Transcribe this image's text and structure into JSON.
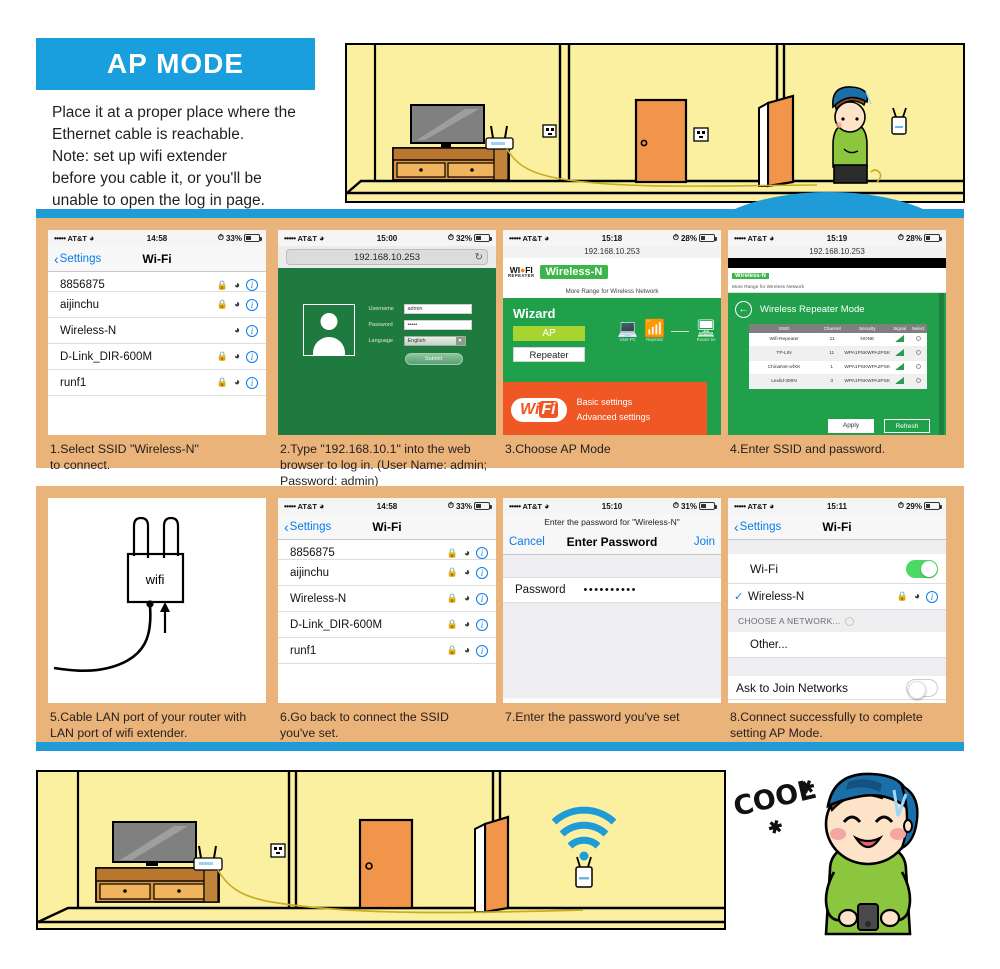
{
  "header": {
    "badge_label": "AP MODE",
    "intro_lines": [
      "Place it at a proper place where the",
      "Ethernet cable is reachable.",
      "Note: set up wifi extender",
      "before you cable it, or you'll be",
      "unable to open the log in page."
    ],
    "badge_color": "#199ede"
  },
  "colors": {
    "accent_blue": "#199ede",
    "panel_orange": "#eab379",
    "router_green": "#1f7a3f",
    "wizard_green": "#21a04c",
    "wifi_orange": "#ef5724",
    "ios_blue": "#0a7ce8",
    "toggle_green": "#4cd964",
    "wall_yellow": "#fbf0a0",
    "door_orange": "#f0954a"
  },
  "steps": [
    {
      "number": "1",
      "caption": "1.Select SSID \"Wireless-N\"\nto connect."
    },
    {
      "number": "2",
      "caption": "2.Type \"192.168.10.1\" into the web\nbrowser to log in. (User Name: admin;\nPassword: admin)"
    },
    {
      "number": "3",
      "caption": "3.Choose AP Mode"
    },
    {
      "number": "4",
      "caption": "4.Enter SSID and password."
    },
    {
      "number": "5",
      "caption": "5.Cable LAN port of your router with\nLAN port of wifi extender."
    },
    {
      "number": "6",
      "caption": "6.Go back to connect the SSID\nyou've set."
    },
    {
      "number": "7",
      "caption": "7.Enter the password you've set"
    },
    {
      "number": "8",
      "caption": "8.Connect successfully to complete\nsetting AP Mode."
    }
  ],
  "screens": {
    "s1_wifi_list": {
      "status": {
        "carrier": "AT&T",
        "signal_dots": "•••••",
        "time": "14:58",
        "battery": "33%"
      },
      "nav": {
        "back_label": "Settings",
        "title": "Wi-Fi"
      },
      "networks": [
        {
          "ssid": "8856875",
          "locked": true
        },
        {
          "ssid": "aijinchu",
          "locked": true
        },
        {
          "ssid": "Wireless-N",
          "locked": false
        },
        {
          "ssid": "D-Link_DIR-600M",
          "locked": true
        },
        {
          "ssid": "runf1",
          "locked": true
        }
      ]
    },
    "s2_login": {
      "status": {
        "carrier": "AT&T",
        "signal_dots": "•••••",
        "time": "15:00",
        "battery": "32%"
      },
      "url": "192.168.10.253",
      "reload_icon": "reload-icon",
      "form": {
        "username_label": "Username",
        "username_value": "admin",
        "password_label": "Password",
        "password_value": "•••••",
        "language_label": "Language",
        "language_value": "English",
        "submit_label": "Submit"
      }
    },
    "s3_wizard": {
      "status": {
        "carrier": "AT&T",
        "signal_dots": "•••••",
        "time": "15:18",
        "battery": "28%"
      },
      "url": "192.168.10.253",
      "brand": {
        "logo_top": "WI FI",
        "logo_sub": "REPEATER",
        "chip": "Wireless-N",
        "tagline": "More Range for Wireless Network"
      },
      "wizard_title": "Wizard",
      "mode_ap": "AP",
      "mode_repeater": "Repeater",
      "diagram": [
        {
          "label": "User-PC",
          "icon": "laptop-icon"
        },
        {
          "label": "Repeater",
          "icon": "repeater-icon"
        },
        {
          "label": "Router Se",
          "icon": "router-icon"
        }
      ],
      "wifi_cloud": "WiFi",
      "links": [
        "Basic settings",
        "Advanced settings"
      ]
    },
    "s4_repeater": {
      "status": {
        "carrier": "AT&T",
        "signal_dots": "•••••",
        "time": "15:19",
        "battery": "28%"
      },
      "url": "192.168.10.253",
      "chip": "Wireless-N",
      "tagline": "More Range for Wireless Network",
      "title": "Wireless Repeater Mode",
      "back_icon": "back-arrow-icon",
      "table": {
        "headers": [
          "SSID",
          "Channel",
          "Security",
          "Signal",
          "Select"
        ],
        "rows": [
          {
            "ssid": "Wifi-Repeater",
            "channel": "11",
            "security": "NONE"
          },
          {
            "ssid": "TP-LIN",
            "channel": "11",
            "security": "WPA1PSKWPA2PSK"
          },
          {
            "ssid": "ChinaNet-wfXK",
            "channel": "1",
            "security": "WPA1PSKWPA2PSK"
          },
          {
            "ssid": "Lexlid-300N",
            "channel": "3",
            "security": "WPA1PSKWPA2PSK"
          }
        ]
      },
      "apply_label": "Apply",
      "refresh_label": "Refresh"
    },
    "s5_cable": {
      "device_label": "wifi",
      "arrow_icon": "up-arrow-icon"
    },
    "s6_wifi_list": {
      "status": {
        "carrier": "AT&T",
        "signal_dots": "•••••",
        "time": "14:58",
        "battery": "33%"
      },
      "nav": {
        "back_label": "Settings",
        "title": "Wi-Fi"
      },
      "networks": [
        {
          "ssid": "8856875",
          "locked": true
        },
        {
          "ssid": "aijinchu",
          "locked": true
        },
        {
          "ssid": "Wireless-N",
          "locked": true
        },
        {
          "ssid": "D-Link_DIR-600M",
          "locked": true
        },
        {
          "ssid": "runf1",
          "locked": true
        }
      ]
    },
    "s7_password": {
      "status": {
        "carrier": "AT&T",
        "signal_dots": "•••••",
        "time": "15:10",
        "battery": "31%"
      },
      "subtitle": "Enter the password for \"Wireless-N\"",
      "cancel_label": "Cancel",
      "title": "Enter Password",
      "join_label": "Join",
      "password_label": "Password",
      "password_value": "••••••••••"
    },
    "s8_connected": {
      "status": {
        "carrier": "AT&T",
        "signal_dots": "•••••",
        "time": "15:11",
        "battery": "29%"
      },
      "nav": {
        "back_label": "Settings",
        "title": "Wi-Fi"
      },
      "wifi_toggle_label": "Wi-Fi",
      "wifi_toggle_on": true,
      "connected_ssid": "Wireless-N",
      "group_header": "CHOOSE A NETWORK...",
      "other_label": "Other...",
      "ask_join_label": "Ask to Join Networks"
    }
  },
  "illustration": {
    "cool_text": "COOL",
    "boy_cap_letter": "N",
    "wifi_icon": "wifi-signal-icon"
  }
}
